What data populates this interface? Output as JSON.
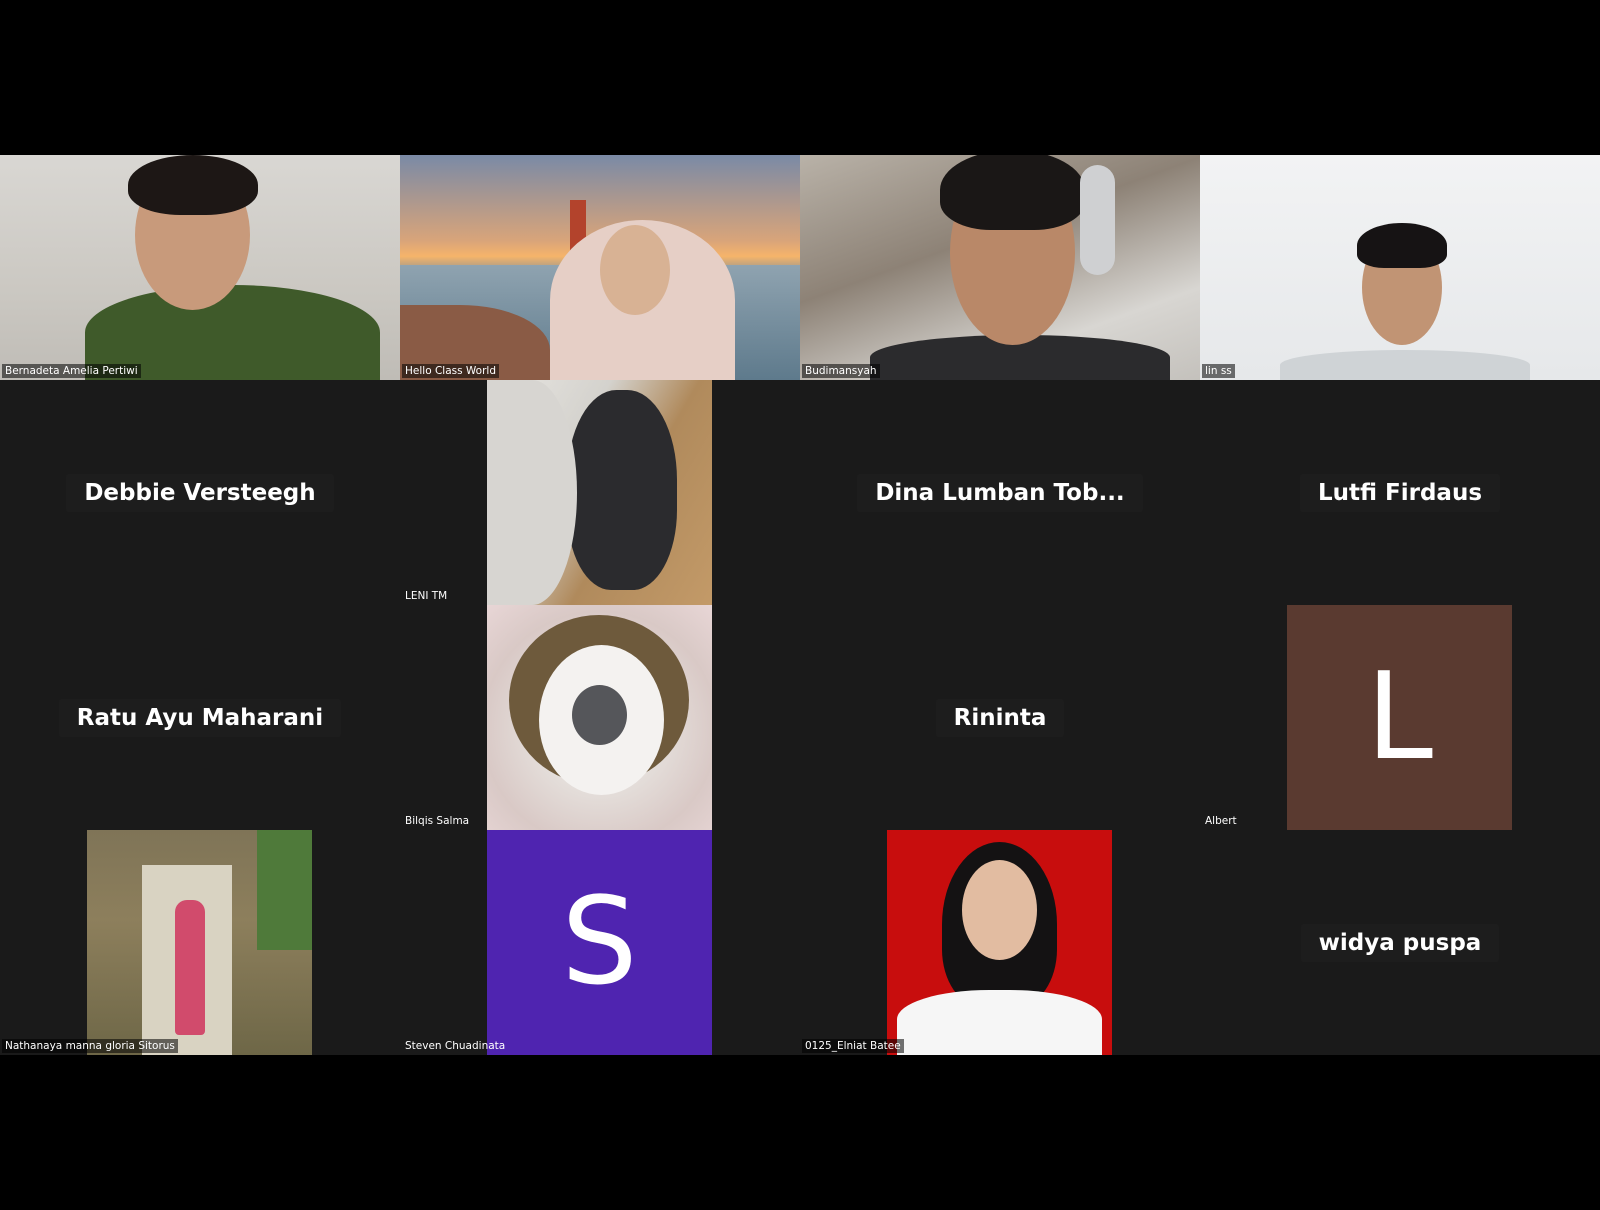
{
  "meeting": {
    "participants_row1": [
      {
        "name": "Bernadeta Amelia Pertiwi"
      },
      {
        "name": "Hello Class World"
      },
      {
        "name": "Budimansyah"
      },
      {
        "name": "lin ss"
      }
    ],
    "debbie": {
      "display": "Debbie Versteegh"
    },
    "leni": {
      "tag": "LENI TM"
    },
    "dina": {
      "display": "Dina Lumban Tob..."
    },
    "lutfi": {
      "display": "Lutfi Firdaus"
    },
    "ratu": {
      "display": "Ratu Ayu Maharani"
    },
    "bilqis": {
      "tag": "Bilqis Salma"
    },
    "rininta": {
      "display": "Rininta"
    },
    "albert": {
      "tag": "Albert",
      "avatar_letter": "L",
      "avatar_color": "#5a3a30"
    },
    "nathanaya": {
      "tag": "Nathanaya manna gloria Sitorus"
    },
    "steven": {
      "tag": "Steven Chuadinata",
      "avatar_letter": "S",
      "avatar_color": "#4f24b0"
    },
    "elniat": {
      "tag": "0125_Elniat Batee"
    },
    "widya": {
      "display": "widya puspa"
    }
  }
}
